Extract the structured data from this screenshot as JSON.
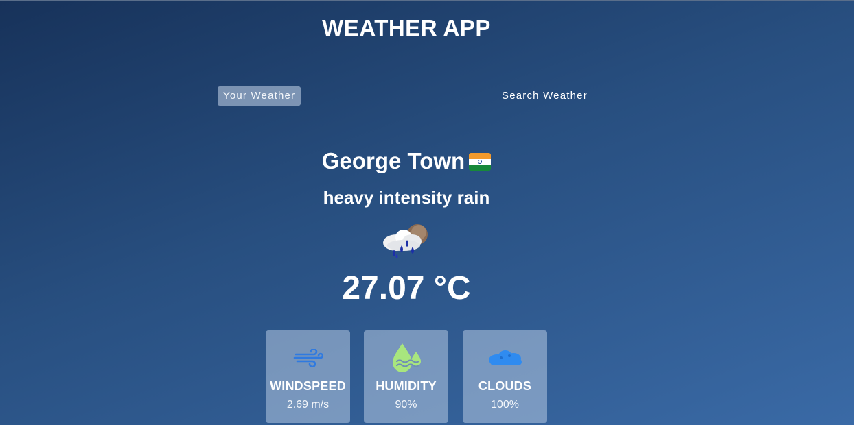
{
  "app": {
    "title": "WEATHER APP"
  },
  "tabs": [
    {
      "label": "Your Weather",
      "active": true
    },
    {
      "label": "Search Weather",
      "active": false
    }
  ],
  "weather": {
    "city": "George Town",
    "flag_icon": "india-flag-icon",
    "description": "heavy intensity rain",
    "condition_icon": "rain-cloud-sun-icon",
    "temperature": "27.07 °C"
  },
  "stats": [
    {
      "label": "WINDSPEED",
      "value": "2.69 m/s",
      "icon": "wind-icon"
    },
    {
      "label": "HUMIDITY",
      "value": "90%",
      "icon": "humidity-drops-icon"
    },
    {
      "label": "CLOUDS",
      "value": "100%",
      "icon": "cloud-icon"
    }
  ],
  "colors": {
    "background_top": "#17325a",
    "background_bottom": "#3a6aa6",
    "card_bg": "#8aa3c4",
    "wind_icon": "#2f7ae0",
    "humidity_icon": "#9be07a",
    "cloud_icon": "#2f8bf0"
  }
}
